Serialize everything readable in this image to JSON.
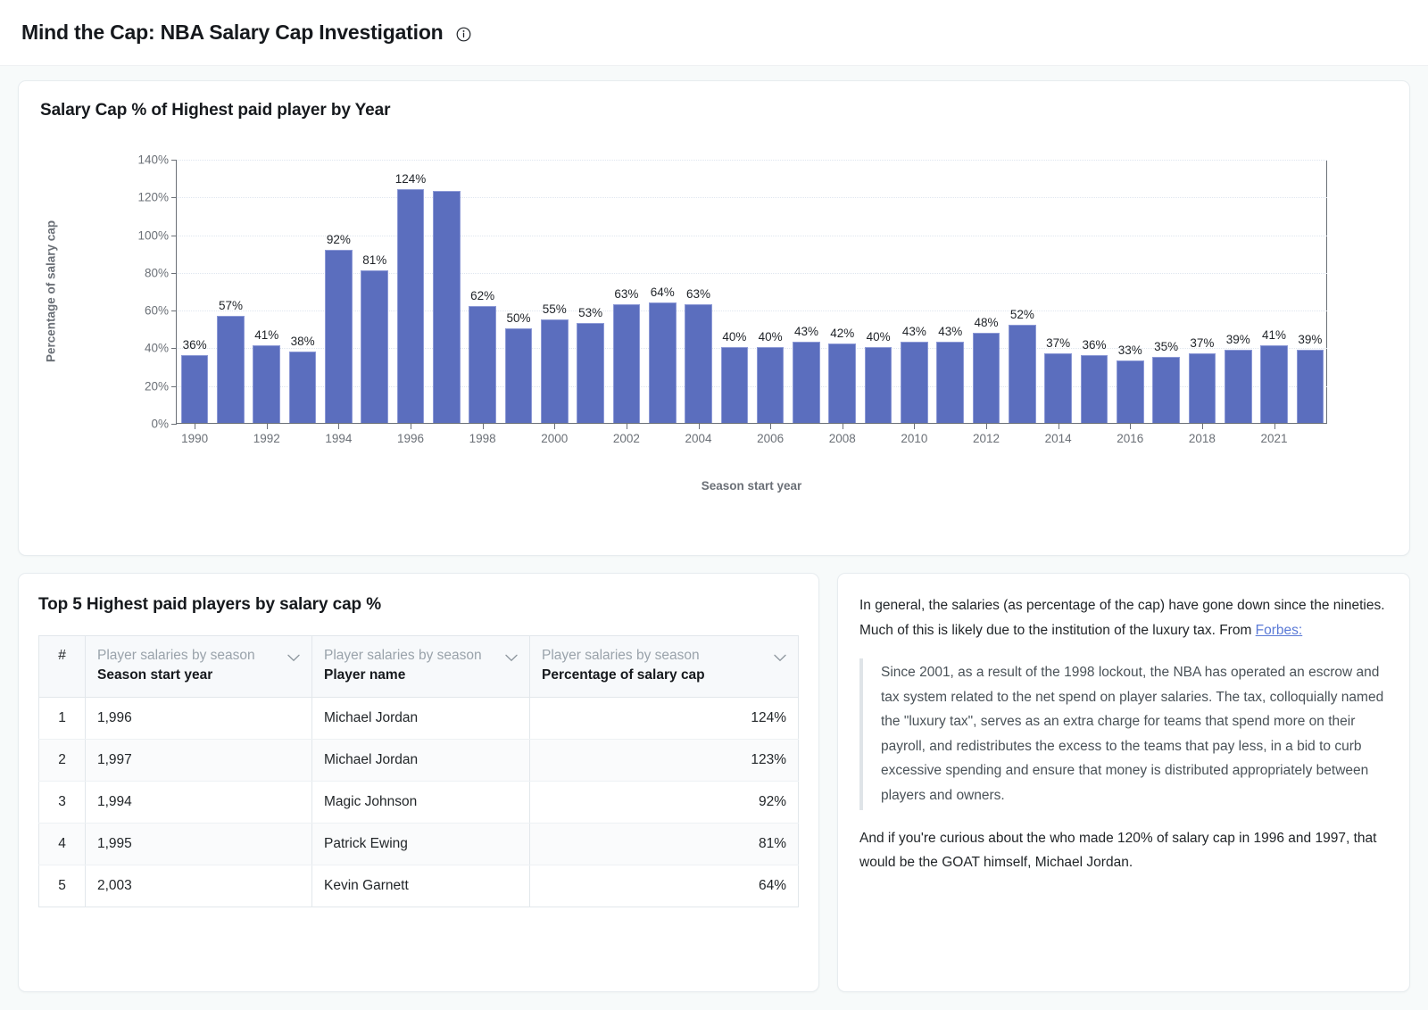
{
  "header": {
    "title": "Mind the Cap: NBA Salary Cap Investigation",
    "info_icon": "info-circle-icon"
  },
  "chart_card": {
    "title": "Salary Cap % of Highest paid player by Year"
  },
  "chart_data": {
    "type": "bar",
    "title": "Salary Cap % of Highest paid player by Year",
    "xlabel": "Season start year",
    "ylabel": "Percentage of salary cap",
    "ylim": [
      0,
      140
    ],
    "ytick_labels": [
      "0%",
      "20%",
      "40%",
      "60%",
      "80%",
      "100%",
      "120%",
      "140%"
    ],
    "ytick_values": [
      0,
      20,
      40,
      60,
      80,
      100,
      120,
      140
    ],
    "grid": true,
    "legend": "none",
    "xtick_labels": [
      "1990",
      "1992",
      "1994",
      "1996",
      "1998",
      "2000",
      "2002",
      "2004",
      "2006",
      "2008",
      "2010",
      "2012",
      "2014",
      "2016",
      "2018",
      "2021"
    ],
    "categories": [
      "1990",
      "1991",
      "1992",
      "1993",
      "1994",
      "1995",
      "1996",
      "1997",
      "1998",
      "1999",
      "2000",
      "2001",
      "2002",
      "2003",
      "2004",
      "2005",
      "2006",
      "2007",
      "2008",
      "2009",
      "2010",
      "2011",
      "2012",
      "2013",
      "2014",
      "2015",
      "2016",
      "2017",
      "2018",
      "2019",
      "2020",
      "2021"
    ],
    "values": [
      36,
      57,
      41,
      38,
      92,
      81,
      124,
      123,
      62,
      50,
      55,
      53,
      63,
      64,
      63,
      40,
      40,
      43,
      42,
      40,
      43,
      43,
      48,
      52,
      37,
      36,
      33,
      35,
      37,
      39,
      41,
      39
    ],
    "point_labels": [
      "36%",
      "57%",
      "41%",
      "38%",
      "92%",
      "81%",
      "124%",
      "",
      "62%",
      "50%",
      "55%",
      "53%",
      "63%",
      "64%",
      "63%",
      "40%",
      "40%",
      "43%",
      "42%",
      "40%",
      "43%",
      "43%",
      "48%",
      "52%",
      "37%",
      "36%",
      "33%",
      "35%",
      "37%",
      "39%",
      "41%",
      "39%"
    ],
    "bar_color": "#5b6ebe"
  },
  "table_card": {
    "title": "Top 5 Highest paid players by salary cap %",
    "columns": [
      {
        "rank_symbol": "#"
      },
      {
        "prefix": "Player salaries by season ",
        "field": "Season start year",
        "chevron": "chevron-down-icon"
      },
      {
        "prefix": "Player salaries by season ",
        "field": "Player name",
        "chevron": "chevron-down-icon"
      },
      {
        "prefix": "Player salaries by season ",
        "field": "Percentage of salary cap",
        "chevron": "chevron-down-icon"
      }
    ],
    "rows": [
      {
        "rank": "1",
        "year": "1,996",
        "player": "Michael Jordan",
        "pct": "124%"
      },
      {
        "rank": "2",
        "year": "1,997",
        "player": "Michael Jordan",
        "pct": "123%"
      },
      {
        "rank": "3",
        "year": "1,994",
        "player": "Magic Johnson",
        "pct": "92%"
      },
      {
        "rank": "4",
        "year": "1,995",
        "player": "Patrick Ewing",
        "pct": "81%"
      },
      {
        "rank": "5",
        "year": "2,003",
        "player": "Kevin Garnett",
        "pct": "64%"
      }
    ]
  },
  "notes_card": {
    "intro_before_link": "In general, the salaries (as percentage of the cap) have gone down since the nineties. Much of this is likely due to the institution of the luxury tax. From ",
    "link_text": "Forbes:",
    "quote": "Since 2001, as a result of the 1998 lockout, the NBA has operated an escrow and tax system related to the net spend on player salaries. The tax, colloquially named the \"luxury tax\", serves as an extra charge for teams that spend more on their payroll, and redistributes the excess to the teams that pay less, in a bid to curb excessive spending and ensure that money is distributed appropriately between players and owners.",
    "outro": "And if you're curious about the who made 120% of salary cap in 1996 and 1997, that would be the GOAT himself, Michael Jordan."
  },
  "colors": {
    "bar": "#5b6ebe",
    "link": "#5b7ad6",
    "page_bg": "#f7fafa",
    "card_border": "#e7ecef"
  }
}
